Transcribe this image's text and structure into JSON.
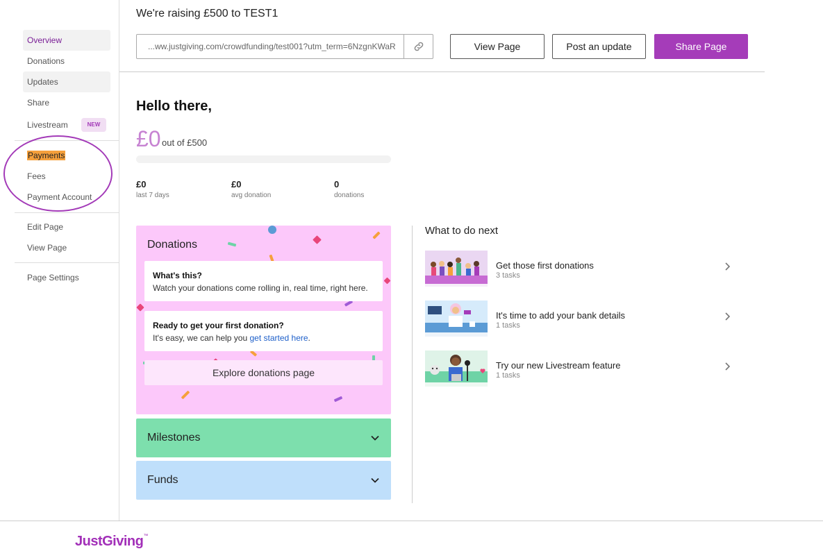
{
  "sidebar": {
    "items": [
      {
        "label": "Overview"
      },
      {
        "label": "Donations"
      },
      {
        "label": "Updates"
      },
      {
        "label": "Share"
      },
      {
        "label": "Livestream",
        "badge": "NEW"
      },
      {
        "label": "Payments"
      },
      {
        "label": "Fees"
      },
      {
        "label": "Payment Account"
      },
      {
        "label": "Edit Page"
      },
      {
        "label": "View Page"
      },
      {
        "label": "Page Settings"
      }
    ]
  },
  "header": {
    "title": "We're raising £500 to TEST1",
    "url": "...ww.justgiving.com/crowdfunding/test001?utm_term=6NzgnKWaR",
    "view_page": "View Page",
    "post_update": "Post an update",
    "share_page": "Share Page"
  },
  "summary": {
    "greeting": "Hello there,",
    "raised": "£0",
    "target_text": "out of £500",
    "progress_fraction": 0,
    "stats": [
      {
        "value": "£0",
        "label": "last 7 days"
      },
      {
        "value": "£0",
        "label": "avg donation"
      },
      {
        "value": "0",
        "label": "donations"
      }
    ]
  },
  "donations_card": {
    "title": "Donations",
    "whats_this_heading": "What's this?",
    "whats_this_text": "Watch your donations come rolling in, real time, right here.",
    "ready_heading": "Ready to get your first donation?",
    "ready_text": "It's easy, we can help you ",
    "ready_link": "get started here",
    "ready_end": ".",
    "explore_button": "Explore donations page"
  },
  "accordions": {
    "milestones": "Milestones",
    "funds": "Funds"
  },
  "next": {
    "heading": "What to do next",
    "tasks": [
      {
        "title": "Get those first donations",
        "sub": "3 tasks"
      },
      {
        "title": "It's time to add your bank details",
        "sub": "1 tasks"
      },
      {
        "title": "Try our new Livestream feature",
        "sub": "1 tasks"
      }
    ]
  },
  "footer": {
    "logo": "JustGiving",
    "logo_tm": "™"
  },
  "colors": {
    "brand_purple": "#a53cb9",
    "donations_pink": "#fcc8fa",
    "milestones_green": "#7ddfad",
    "funds_blue": "#bfdffb",
    "highlight_orange": "#f5a03c"
  }
}
